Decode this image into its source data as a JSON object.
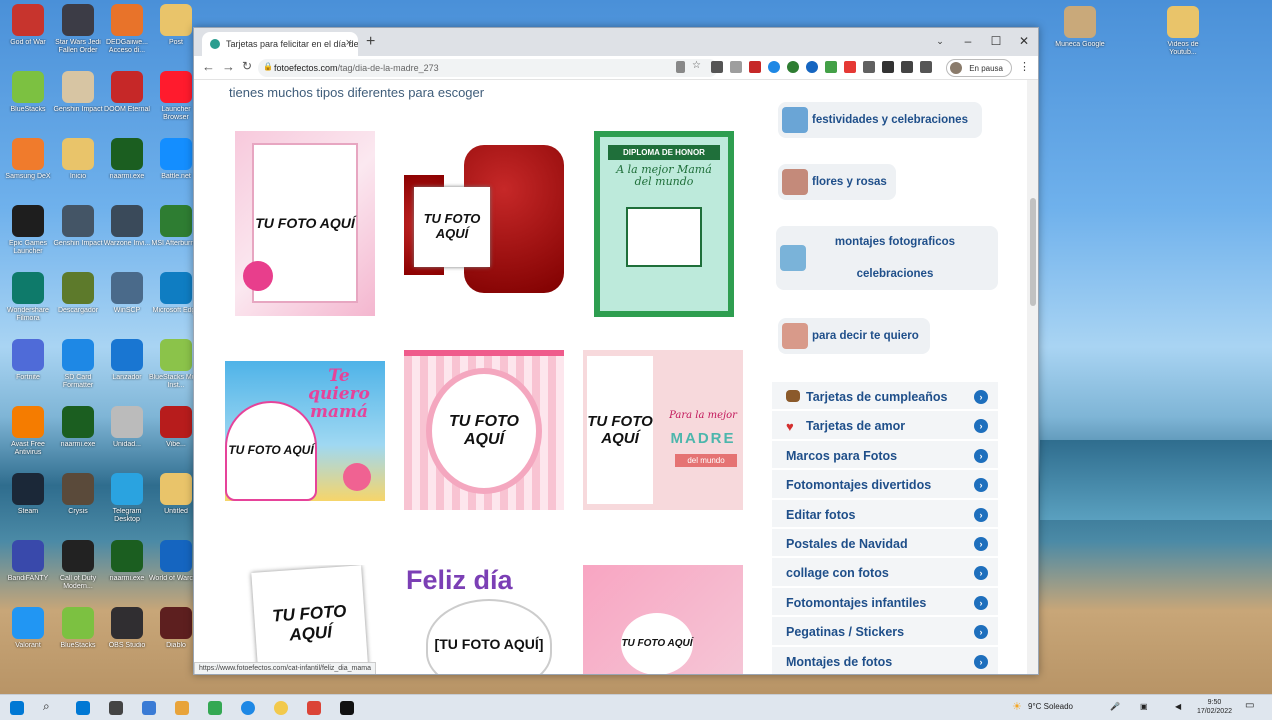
{
  "desktop": {
    "left_icons": [
      {
        "label": "God of War",
        "color": "#c7342d"
      },
      {
        "label": "Star Wars Jedi Fallen Order",
        "color": "#3c3c46"
      },
      {
        "label": "DEDGaiiwe... Acceso di...",
        "color": "#e8732a"
      },
      {
        "label": "Post",
        "color": "#e9c46a"
      },
      {
        "label": "BlueStacks",
        "color": "#7cc141"
      },
      {
        "label": "Genshin Impact",
        "color": "#d7c5a3"
      },
      {
        "label": "DOOM Eternal",
        "color": "#c62828"
      },
      {
        "label": "Launcher Browser",
        "color": "#ff1b2d"
      },
      {
        "label": "Samsung DeX",
        "color": "#f07b2c"
      },
      {
        "label": "Inicio",
        "color": "#e9c46a"
      },
      {
        "label": "naarmi.exe",
        "color": "#1b5e20"
      },
      {
        "label": "Battle.net",
        "color": "#148eff"
      },
      {
        "label": "Epic Games Launcher",
        "color": "#1e1e1e"
      },
      {
        "label": "Genshin Impact",
        "color": "#445566"
      },
      {
        "label": "Warzone Invi...",
        "color": "#3a4a5a"
      },
      {
        "label": "MSI Afterburner",
        "color": "#2e7d32"
      },
      {
        "label": "Wondershare Filmora",
        "color": "#0e7a6a"
      },
      {
        "label": "Descargador",
        "color": "#5d7a2b"
      },
      {
        "label": "WinSCP",
        "color": "#4a6a8a"
      },
      {
        "label": "Microsoft Edge",
        "color": "#0f7dc2"
      },
      {
        "label": "Fortnite",
        "color": "#4f6bd8"
      },
      {
        "label": "SD Card Formatter",
        "color": "#1e88e5"
      },
      {
        "label": "Lanzador",
        "color": "#1976d2"
      },
      {
        "label": "BlueStacks Multi-Inst...",
        "color": "#8bc34a"
      },
      {
        "label": "Avast Free Antivirus",
        "color": "#f57c00"
      },
      {
        "label": "naarmi.exe",
        "color": "#1b5e20"
      },
      {
        "label": "Unidad...",
        "color": "#bbbbbb"
      },
      {
        "label": "Vibe...",
        "color": "#b71c1c"
      },
      {
        "label": "Steam",
        "color": "#1b2838"
      },
      {
        "label": "Crysis",
        "color": "#5a4a3a"
      },
      {
        "label": "Telegram Desktop",
        "color": "#2aa3e0"
      },
      {
        "label": "Untitled",
        "color": "#e9c46a"
      },
      {
        "label": "BandiFANTY",
        "color": "#3949ab"
      },
      {
        "label": "Call of Duty Modern...",
        "color": "#222222"
      },
      {
        "label": "naarmi.exe",
        "color": "#1b5e20"
      },
      {
        "label": "World of Warcraft",
        "color": "#1565c0"
      },
      {
        "label": "Valorant",
        "color": "#2196f3"
      },
      {
        "label": "BlueStacks",
        "color": "#7cc141"
      },
      {
        "label": "OBS Studio",
        "color": "#302e31"
      },
      {
        "label": "Diablo",
        "color": "#5d1f1f"
      }
    ],
    "right_icons": [
      {
        "label": "Muneca Google",
        "color": "#c9a97a"
      },
      {
        "label": "Videos de Youtub...",
        "color": "#e9c46a"
      }
    ]
  },
  "browser": {
    "tab_title": "Tarjetas para felicitar en el día de...",
    "tab_close": "×",
    "new_tab": "+",
    "window_controls": {
      "chevron": "⌄",
      "minimize": "–",
      "maximize": "☐",
      "close": "✕"
    },
    "url_domain": "fotoefectos.com",
    "url_path": "/tag/dia-de-la-madre_273",
    "profile_status": "En pausa",
    "status_url": "https://www.fotoefectos.com/cat-infantil/feliz_dia_mama"
  },
  "page": {
    "intro_text": "tienes muchos tipos diferentes para escoger",
    "cards": [
      {
        "photo_text": "TU FOTO AQUÍ",
        "theme": "pink-floral-frame"
      },
      {
        "photo_text": "TU FOTO AQUÍ",
        "theme": "red-roses"
      },
      {
        "banner": "DIPLOMA DE HONOR",
        "script": "A la mejor Mamá del mundo",
        "theme": "diploma"
      },
      {
        "photo_text": "TU FOTO AQUÍ",
        "script": "Te quiero mamá",
        "theme": "heart-flowers"
      },
      {
        "photo_text": "TU FOTO AQUÍ",
        "theme": "striped-wreath"
      },
      {
        "photo_text": "TU FOTO AQUÍ",
        "script": "Para la mejor",
        "banner": "MADRE",
        "sub": "del mundo",
        "theme": "madre"
      },
      {
        "photo_text": "TU FOTO AQUÍ",
        "theme": "tilted-roses"
      },
      {
        "photo_text": "[TU FOTO AQUÍ]",
        "script": "Feliz día",
        "theme": "feliz-dia"
      },
      {
        "photo_text": "TU FOTO AQUÍ",
        "theme": "cupcakes"
      }
    ]
  },
  "sidebar": {
    "tags": [
      {
        "label": "festividades y celebraciones",
        "color": "#6aa5d6"
      },
      {
        "label": "flores y rosas",
        "color": "#c48a7a"
      },
      {
        "label": "montajes fotograficos celebraciones",
        "color": "#7ab3d9"
      },
      {
        "label": "para decir te quiero",
        "color": "#d89a8a"
      }
    ],
    "categories": [
      {
        "label": "Tarjetas de cumpleaños",
        "emoji_color": "#8b5a2b"
      },
      {
        "label": "Tarjetas de amor",
        "emoji_color": "#d32f2f"
      },
      {
        "label": "Marcos para Fotos"
      },
      {
        "label": "Fotomontajes divertidos"
      },
      {
        "label": "Editar fotos"
      },
      {
        "label": "Postales de Navidad"
      },
      {
        "label": "collage con fotos"
      },
      {
        "label": "Fotomontajes infantiles"
      },
      {
        "label": "Pegatinas / Stickers"
      },
      {
        "label": "Montajes de fotos"
      }
    ],
    "arrow": "›"
  },
  "taskbar": {
    "weather": "9°C  Soleado",
    "time": "9:50",
    "date": "17/02/2022",
    "icons": [
      "#0078d4",
      "#444444",
      "#3a7bd5",
      "#e8a33a",
      "#34a853",
      "#1e88e5",
      "#f2c94c",
      "#db4437",
      "#111111"
    ]
  }
}
